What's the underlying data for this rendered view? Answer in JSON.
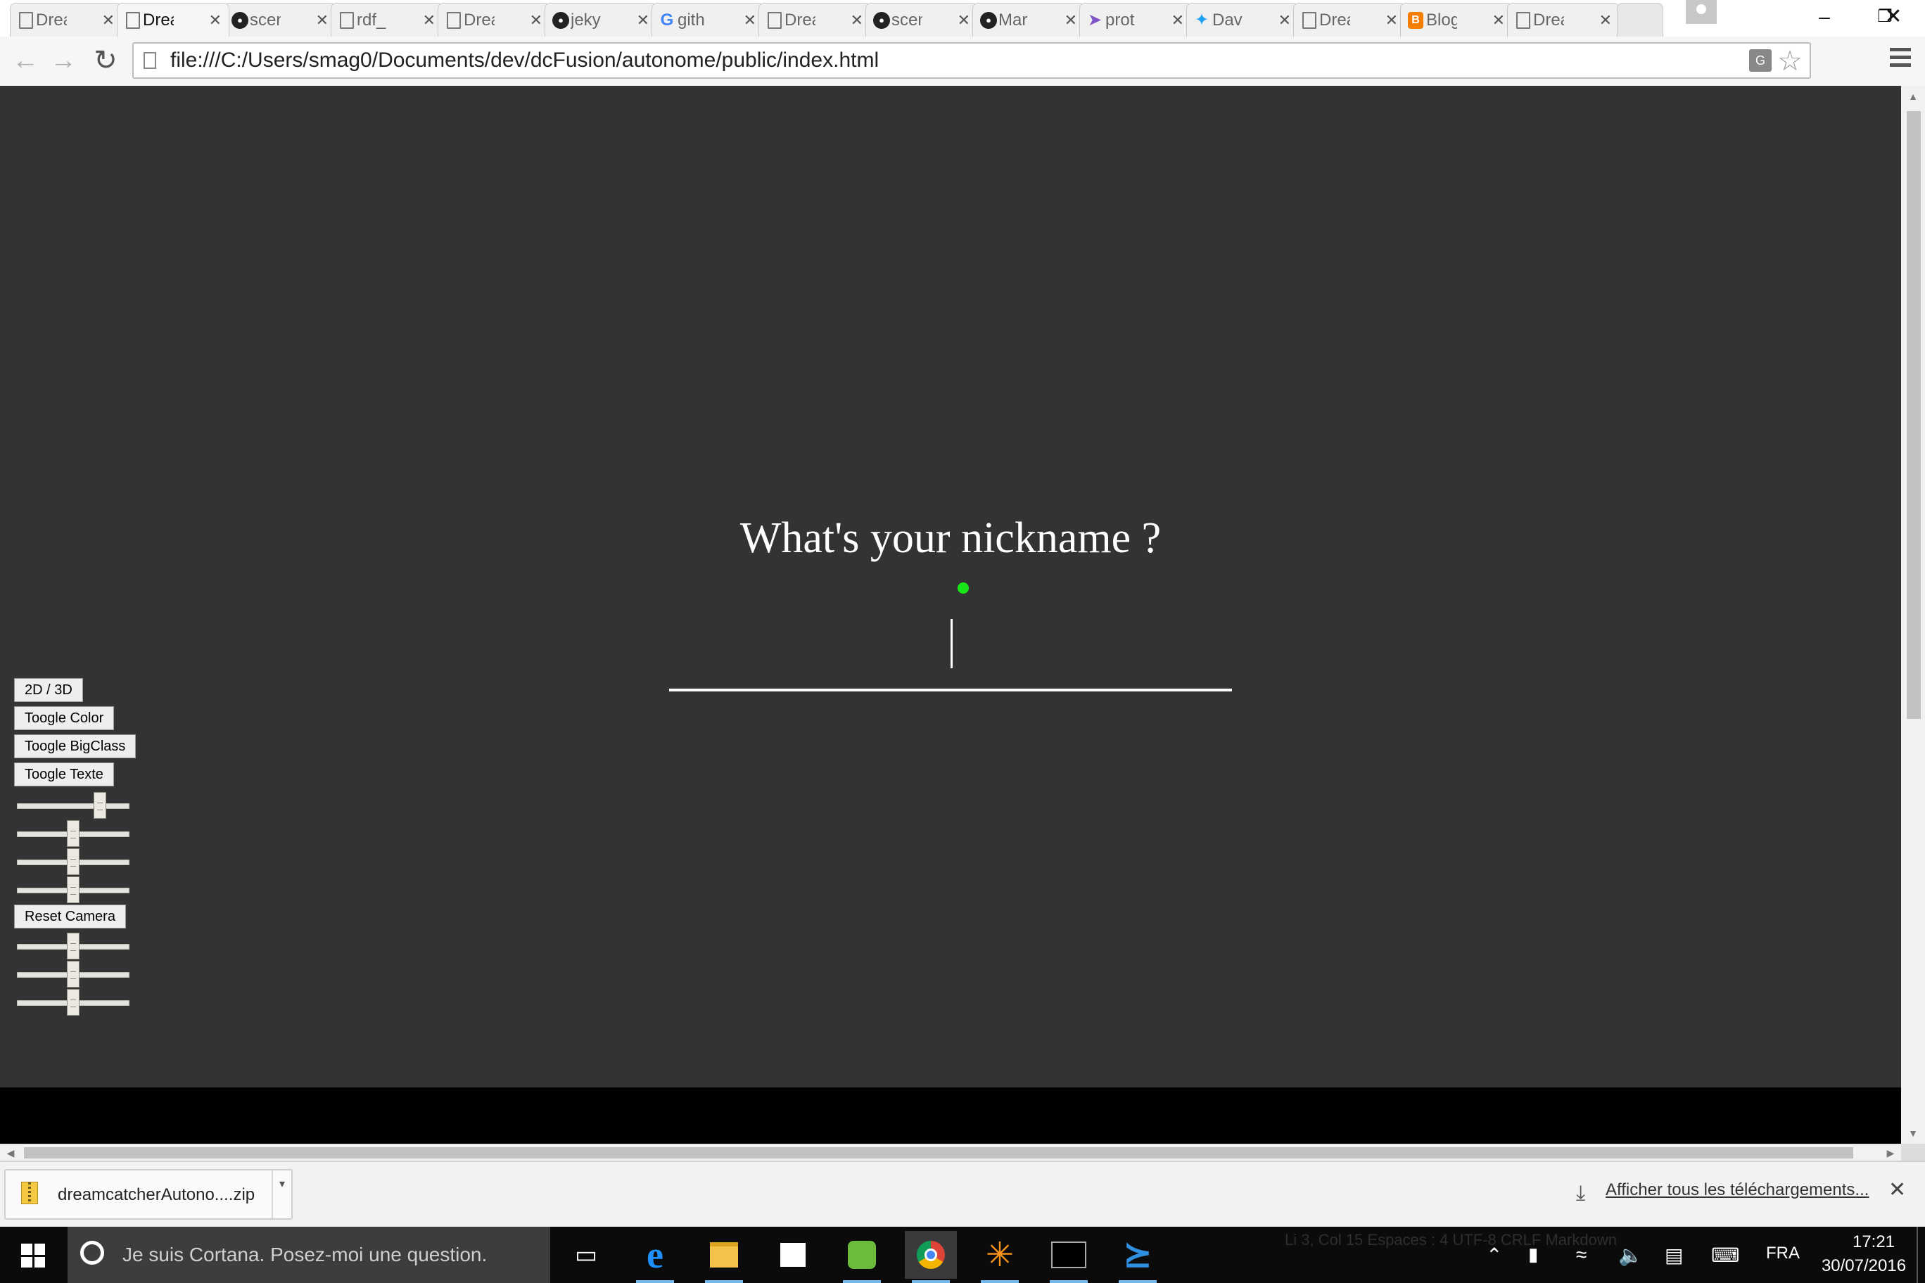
{
  "tabs": [
    {
      "title": "Drea",
      "icon": "document-icon"
    },
    {
      "title": "Drea",
      "icon": "document-icon",
      "active": true
    },
    {
      "title": "scen",
      "icon": "github-icon"
    },
    {
      "title": "rdf_",
      "icon": "document-icon"
    },
    {
      "title": "Drea",
      "icon": "document-icon"
    },
    {
      "title": "jeky",
      "icon": "github-icon"
    },
    {
      "title": "gith",
      "icon": "google-icon"
    },
    {
      "title": "Drea",
      "icon": "document-icon"
    },
    {
      "title": "scen",
      "icon": "github-icon"
    },
    {
      "title": "Mar",
      "icon": "github-icon"
    },
    {
      "title": "prot",
      "icon": "arrow-icon"
    },
    {
      "title": "Dav",
      "icon": "twitter-icon"
    },
    {
      "title": "Drea",
      "icon": "document-icon"
    },
    {
      "title": "Blog",
      "icon": "blogger-icon"
    },
    {
      "title": "Drea",
      "icon": "document-icon"
    }
  ],
  "toolbar": {
    "url": "file:///C:/Users/smag0/Documents/dev/dcFusion/autonome/public/index.html"
  },
  "page": {
    "prompt": "What's your nickname ?",
    "nickname_value": "",
    "status_color": "#19e619",
    "background": "#333333"
  },
  "controls": {
    "btn_2d3d": "2D / 3D",
    "btn_color": "Toogle Color",
    "btn_bigclass": "Toogle BigClass",
    "btn_texte": "Toogle Texte",
    "btn_reset": "Reset Camera",
    "sliders_top": [
      0.74,
      0.5,
      0.5,
      0.5
    ],
    "sliders_bottom": [
      0.5,
      0.5,
      0.5
    ]
  },
  "download": {
    "filename": "dreamcatcherAutono....zip",
    "show_all": "Afficher tous les téléchargements..."
  },
  "taskbar": {
    "cortana": "Je suis Cortana. Posez-moi une question.",
    "vs_status": "Li 3, Col 15    Espaces : 4    UTF-8    CRLF    Markdown",
    "lang": "FRA",
    "time": "17:21",
    "date": "30/07/2016"
  }
}
